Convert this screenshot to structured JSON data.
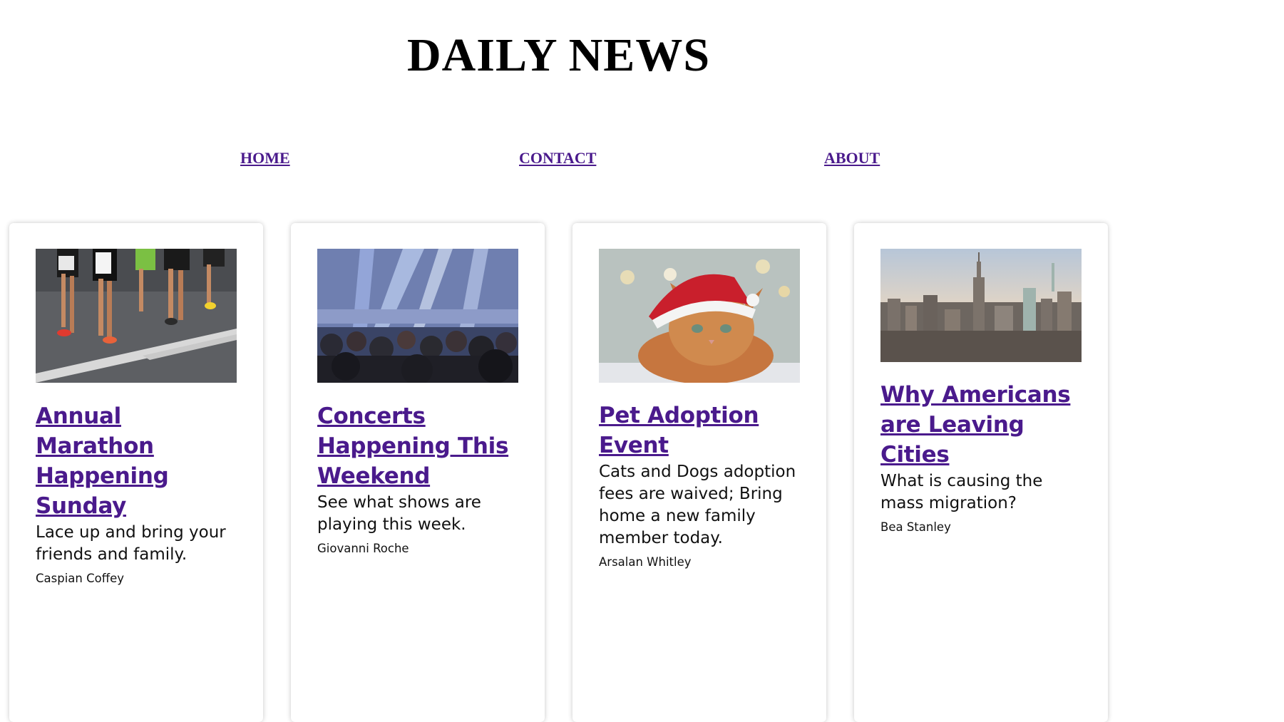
{
  "site": {
    "title": "DAILY NEWS"
  },
  "nav": {
    "home": "HOME",
    "contact": "CONTACT",
    "about": "ABOUT"
  },
  "articles": [
    {
      "image_icon": "marathon-runners-photo",
      "headline": "Annual Marathon Happening Sunday",
      "summary": "Lace up and bring your friends and family.",
      "author": "Caspian Coffey"
    },
    {
      "image_icon": "concert-crowd-photo",
      "headline": "Concerts Happening This Weekend",
      "summary": "See what shows are playing this week.",
      "author": "Giovanni Roche"
    },
    {
      "image_icon": "cat-santa-hat-photo",
      "headline": "Pet Adoption Event",
      "summary": "Cats and Dogs adoption fees are waived; Bring home a new family member today.",
      "author": "Arsalan Whitley"
    },
    {
      "image_icon": "city-skyline-photo",
      "headline": "Why Americans are Leaving Cities",
      "summary": "What is causing the mass migration?",
      "author": "Bea Stanley"
    }
  ],
  "colors": {
    "link": "#4a1a8c",
    "text": "#111111",
    "background": "#ffffff"
  }
}
